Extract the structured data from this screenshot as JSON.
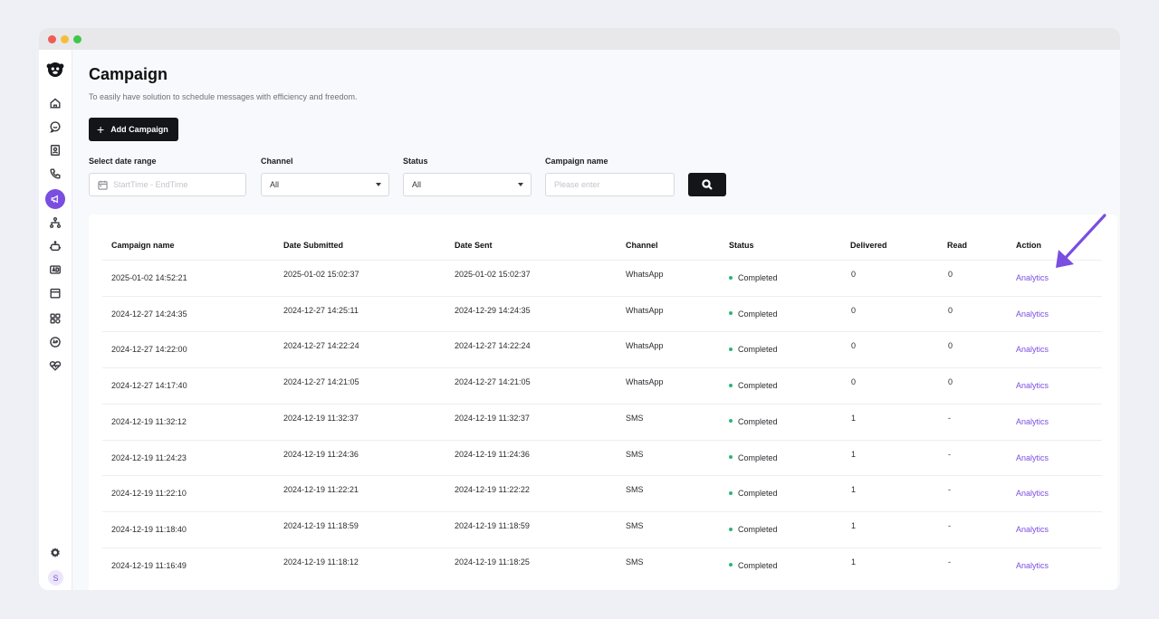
{
  "page": {
    "title": "Campaign",
    "subtitle": "To easily have solution to schedule messages with efficiency and freedom."
  },
  "toolbar": {
    "add_label": "Add Campaign"
  },
  "filters": {
    "date_label": "Select date range",
    "date_placeholder": "StartTime - EndTime",
    "channel_label": "Channel",
    "channel_value": "All",
    "status_label": "Status",
    "status_value": "All",
    "name_label": "Campaign name",
    "name_placeholder": "Please enter"
  },
  "sidebar": {
    "avatar_initial": "S",
    "items": [
      "home-icon",
      "chat-icon",
      "contacts-icon",
      "phone-icon",
      "campaign-icon",
      "flow-icon",
      "bot-icon",
      "ad-icon",
      "calendar-icon",
      "apps-icon",
      "api-icon",
      "health-icon",
      "settings-icon"
    ],
    "active": "campaign-icon",
    "accent": "#7a4ee0"
  },
  "table": {
    "headers": [
      "Campaign name",
      "Date Submitted",
      "Date Sent",
      "Channel",
      "Status",
      "Delivered",
      "Read",
      "Action"
    ],
    "rows": [
      {
        "name": "2025-01-02 14:52:21",
        "submitted": "2025-01-02 15:02:37",
        "sent": "2025-01-02 15:02:37",
        "channel": "WhatsApp",
        "status": "Completed",
        "delivered": "0",
        "read": "0",
        "action": "Analytics"
      },
      {
        "name": "2024-12-27 14:24:35",
        "submitted": "2024-12-27 14:25:11",
        "sent": "2024-12-29 14:24:35",
        "channel": "WhatsApp",
        "status": "Completed",
        "delivered": "0",
        "read": "0",
        "action": "Analytics"
      },
      {
        "name": "2024-12-27 14:22:00",
        "submitted": "2024-12-27 14:22:24",
        "sent": "2024-12-27 14:22:24",
        "channel": "WhatsApp",
        "status": "Completed",
        "delivered": "0",
        "read": "0",
        "action": "Analytics"
      },
      {
        "name": "2024-12-27 14:17:40",
        "submitted": "2024-12-27 14:21:05",
        "sent": "2024-12-27 14:21:05",
        "channel": "WhatsApp",
        "status": "Completed",
        "delivered": "0",
        "read": "0",
        "action": "Analytics"
      },
      {
        "name": "2024-12-19 11:32:12",
        "submitted": "2024-12-19 11:32:37",
        "sent": "2024-12-19 11:32:37",
        "channel": "SMS",
        "status": "Completed",
        "delivered": "1",
        "read": "-",
        "action": "Analytics"
      },
      {
        "name": "2024-12-19 11:24:23",
        "submitted": "2024-12-19 11:24:36",
        "sent": "2024-12-19 11:24:36",
        "channel": "SMS",
        "status": "Completed",
        "delivered": "1",
        "read": "-",
        "action": "Analytics"
      },
      {
        "name": "2024-12-19 11:22:10",
        "submitted": "2024-12-19 11:22:21",
        "sent": "2024-12-19 11:22:22",
        "channel": "SMS",
        "status": "Completed",
        "delivered": "1",
        "read": "-",
        "action": "Analytics"
      },
      {
        "name": "2024-12-19 11:18:40",
        "submitted": "2024-12-19 11:18:59",
        "sent": "2024-12-19 11:18:59",
        "channel": "SMS",
        "status": "Completed",
        "delivered": "1",
        "read": "-",
        "action": "Analytics"
      },
      {
        "name": "2024-12-19 11:16:49",
        "submitted": "2024-12-19 11:18:12",
        "sent": "2024-12-19 11:18:25",
        "channel": "SMS",
        "status": "Completed",
        "delivered": "1",
        "read": "-",
        "action": "Analytics"
      }
    ]
  },
  "colors": {
    "accent": "#7a4ee0",
    "status_completed": "#2bb673",
    "button_dark": "#141519",
    "annotation_arrow": "#7a4ee0"
  }
}
